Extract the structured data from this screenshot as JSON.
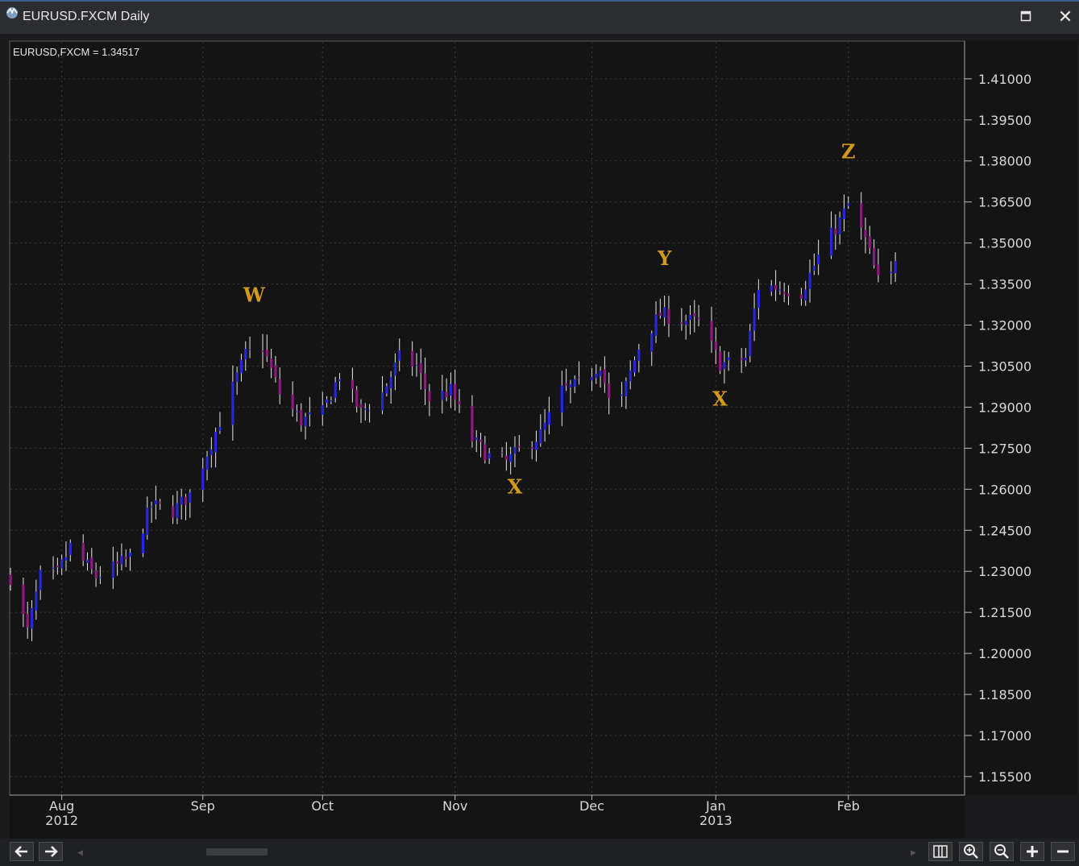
{
  "window": {
    "title": "EURUSD.FXCM Daily",
    "maximize_icon": "maximize-icon",
    "close_label": "✕"
  },
  "toolbar": {
    "back_label": "🡐",
    "forward_label": "🡒",
    "icons": [
      "arrow-left-icon",
      "arrow-right-icon",
      "columns-icon",
      "zoom-in-icon",
      "zoom-out-icon",
      "plus-icon",
      "minus-icon"
    ]
  },
  "colors": {
    "background": "#151515",
    "grid": "#3c3c3c",
    "up_candle": "#2727d6",
    "down_candle": "#8e1a80",
    "wick": "#e6e6e6",
    "wave_label": "#d39a1a",
    "axis_text": "#d8d8d8"
  },
  "chart_data": {
    "type": "candlestick",
    "title": "EURUSD,FXCM = 1.34517",
    "symbol": "EURUSD,FXCM",
    "last_price": "1.34517",
    "ylim": [
      1.1485,
      1.4235
    ],
    "y_ticks": [
      "1.41000",
      "1.39500",
      "1.38000",
      "1.36500",
      "1.35000",
      "1.33500",
      "1.32000",
      "1.30500",
      "1.29000",
      "1.27500",
      "1.26000",
      "1.24500",
      "1.23000",
      "1.21500",
      "1.20000",
      "1.18500",
      "1.17000",
      "1.15500"
    ],
    "x_ticks": [
      {
        "date": "2012-08-01",
        "label": "Aug",
        "year": "2012"
      },
      {
        "date": "2012-09-03",
        "label": "Sep",
        "year": ""
      },
      {
        "date": "2012-10-01",
        "label": "Oct",
        "year": ""
      },
      {
        "date": "2012-11-01",
        "label": "Nov",
        "year": ""
      },
      {
        "date": "2012-12-03",
        "label": "Dec",
        "year": ""
      },
      {
        "date": "2013-01-01",
        "label": "Jan",
        "year": "2013"
      },
      {
        "date": "2013-02-01",
        "label": "Feb",
        "year": ""
      }
    ],
    "x_range": [
      "2012-07-20",
      "2013-02-28"
    ],
    "grid": true,
    "price_path": [
      [
        "2012-07-20",
        1.228
      ],
      [
        "2012-07-24",
        1.208
      ],
      [
        "2012-07-27",
        1.228
      ],
      [
        "2012-07-31",
        1.229
      ],
      [
        "2012-08-03",
        1.239
      ],
      [
        "2012-08-09",
        1.228
      ],
      [
        "2012-08-14",
        1.232
      ],
      [
        "2012-08-17",
        1.235
      ],
      [
        "2012-08-22",
        1.254
      ],
      [
        "2012-08-27",
        1.252
      ],
      [
        "2012-08-31",
        1.258
      ],
      [
        "2012-09-06",
        1.281
      ],
      [
        "2012-09-13",
        1.309
      ],
      [
        "2012-09-17",
        1.312
      ],
      [
        "2012-09-21",
        1.295
      ],
      [
        "2012-09-26",
        1.285
      ],
      [
        "2012-10-01",
        1.288
      ],
      [
        "2012-10-05",
        1.302
      ],
      [
        "2012-10-10",
        1.288
      ],
      [
        "2012-10-15",
        1.295
      ],
      [
        "2012-10-19",
        1.308
      ],
      [
        "2012-10-23",
        1.305
      ],
      [
        "2012-10-26",
        1.293
      ],
      [
        "2012-10-31",
        1.296
      ],
      [
        "2012-11-05",
        1.278
      ],
      [
        "2012-11-09",
        1.272
      ],
      [
        "2012-11-13",
        1.27
      ],
      [
        "2012-11-16",
        1.274
      ],
      [
        "2012-11-21",
        1.28
      ],
      [
        "2012-11-26",
        1.296
      ],
      [
        "2012-11-30",
        1.298
      ],
      [
        "2012-12-05",
        1.306
      ],
      [
        "2012-12-07",
        1.292
      ],
      [
        "2012-12-10",
        1.293
      ],
      [
        "2012-12-14",
        1.312
      ],
      [
        "2012-12-19",
        1.324
      ],
      [
        "2012-12-24",
        1.322
      ],
      [
        "2012-12-28",
        1.321
      ],
      [
        "2013-01-02",
        1.306
      ],
      [
        "2013-01-04",
        1.306
      ],
      [
        "2013-01-08",
        1.308
      ],
      [
        "2013-01-11",
        1.334
      ],
      [
        "2013-01-15",
        1.334
      ],
      [
        "2013-01-21",
        1.332
      ],
      [
        "2013-01-25",
        1.345
      ],
      [
        "2013-01-30",
        1.358
      ],
      [
        "2013-02-01",
        1.364
      ],
      [
        "2013-02-05",
        1.351
      ],
      [
        "2013-02-08",
        1.336
      ],
      [
        "2013-02-11",
        1.338
      ],
      [
        "2013-02-12",
        1.3452
      ]
    ],
    "annotations": [
      {
        "label": "W",
        "date": "2012-09-15",
        "price": 1.3285
      },
      {
        "label": "X",
        "date": "2012-11-15",
        "price": 1.2585
      },
      {
        "label": "Y",
        "date": "2012-12-20",
        "price": 1.342
      },
      {
        "label": "X",
        "date": "2013-01-02",
        "price": 1.2905
      },
      {
        "label": "Z",
        "date": "2013-02-01",
        "price": 1.381
      }
    ]
  }
}
